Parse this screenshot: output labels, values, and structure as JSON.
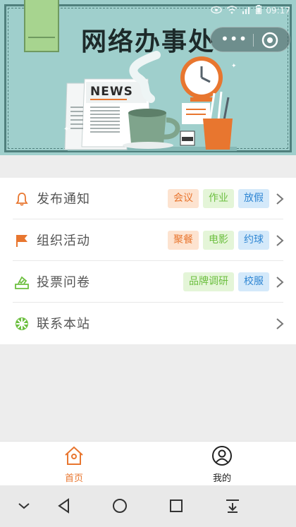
{
  "status_bar": {
    "time": "09:17"
  },
  "banner": {
    "title": "网络办事处",
    "news_label": "NEWS"
  },
  "menu": {
    "items": [
      {
        "label": "发布通知",
        "icon": "bell-icon",
        "tags": [
          {
            "text": "会议",
            "color": "orange"
          },
          {
            "text": "作业",
            "color": "green"
          },
          {
            "text": "放假",
            "color": "blue"
          }
        ]
      },
      {
        "label": "组织活动",
        "icon": "flag-icon",
        "tags": [
          {
            "text": "聚餐",
            "color": "orange"
          },
          {
            "text": "电影",
            "color": "green"
          },
          {
            "text": "约球",
            "color": "blue"
          }
        ]
      },
      {
        "label": "投票问卷",
        "icon": "ballot-icon",
        "tags": [
          {
            "text": "品牌调研",
            "color": "green"
          },
          {
            "text": "校服",
            "color": "blue"
          }
        ]
      },
      {
        "label": "联系本站",
        "icon": "wheel-icon",
        "tags": []
      }
    ]
  },
  "tabbar": {
    "home_label": "首页",
    "mine_label": "我的"
  },
  "colors": {
    "accent": "#e8762f",
    "tag_green": "#6cbf3f",
    "tag_blue": "#2f86d3",
    "banner_bg": "#9fcfcc"
  }
}
